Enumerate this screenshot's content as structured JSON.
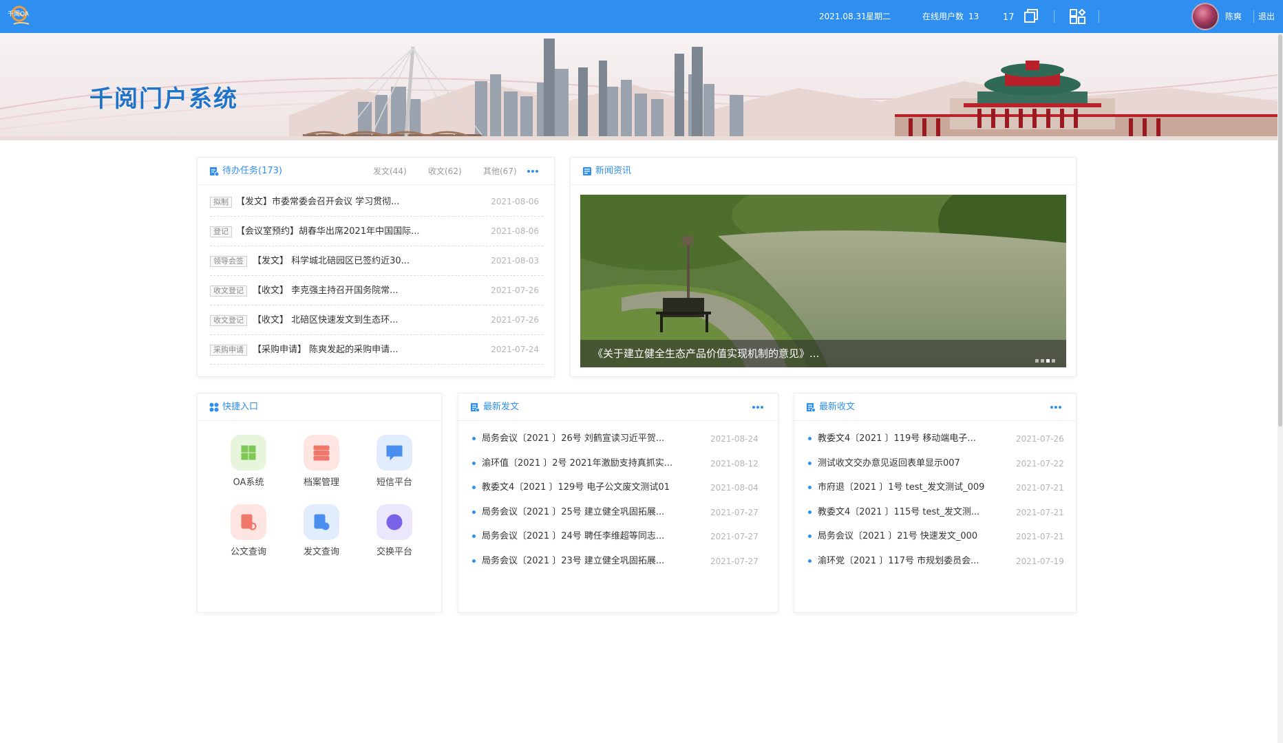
{
  "topbar": {
    "logo_text": "千阅OA",
    "date": "2021.08.31",
    "weekday": "星期二",
    "online_label": "在线用户数",
    "online_count": "13",
    "message_count": "17",
    "username": "陈爽",
    "logout": "退出",
    "bar_color": "#2f8ff0"
  },
  "banner": {
    "title": "千阅门户系统"
  },
  "tasks": {
    "title": "待办任务(173)",
    "tabs": [
      "发文(44)",
      "收文(62)",
      "其他(67)"
    ],
    "items": [
      {
        "tag": "拟制",
        "text": "【发文】市委常委会召开会议 学习贯彻...",
        "date": "2021-08-06"
      },
      {
        "tag": "登记",
        "text": "【会议室预约】胡春华出席2021年中国国际...",
        "date": "2021-08-06"
      },
      {
        "tag": "领导会签",
        "text": "【发文】 科学城北碚园区已签约近30...",
        "date": "2021-08-03"
      },
      {
        "tag": "收文登记",
        "text": "【收文】 李克强主持召开国务院常...",
        "date": "2021-07-26"
      },
      {
        "tag": "收文登记",
        "text": "【收文】 北碚区快速发文到生态环...",
        "date": "2021-07-26"
      },
      {
        "tag": "采购申请",
        "text": "【采购申请】 陈爽发起的采购申请...",
        "date": "2021-07-24"
      }
    ]
  },
  "news": {
    "title": "新闻资讯",
    "caption": "《关于建立健全生态产品价值实现机制的意见》..."
  },
  "quick": {
    "title": "快捷入口",
    "items": [
      {
        "label": "OA系统",
        "icon": "windows-icon",
        "color": "#7dc857",
        "bg": "#e6f5dc"
      },
      {
        "label": "档案管理",
        "icon": "archive-icon",
        "color": "#f0786a",
        "bg": "#fde5e2"
      },
      {
        "label": "短信平台",
        "icon": "message-icon",
        "color": "#4a8ef0",
        "bg": "#e1edfd"
      },
      {
        "label": "公文查询",
        "icon": "doc-search-icon",
        "color": "#f0786a",
        "bg": "#fde5e2"
      },
      {
        "label": "发文查询",
        "icon": "doc-send-icon",
        "color": "#4a8ef0",
        "bg": "#e1edfd"
      },
      {
        "label": "交换平台",
        "icon": "exchange-icon",
        "color": "#7a62e8",
        "bg": "#ebe6fb"
      }
    ]
  },
  "sent": {
    "title": "最新发文",
    "items": [
      {
        "text": "局务会议〔2021 〕26号 刘鹤宣读习近平贺...",
        "date": "2021-08-24"
      },
      {
        "text": "渝环值〔2021 〕2号 2021年激励支持真抓实...",
        "date": "2021-08-12"
      },
      {
        "text": "教委文4〔2021 〕129号 电子公文废文测试01",
        "date": "2021-08-04"
      },
      {
        "text": "局务会议〔2021 〕25号 建立健全巩固拓展...",
        "date": "2021-07-27"
      },
      {
        "text": "局务会议〔2021 〕24号 聘任李维超等同志...",
        "date": "2021-07-27"
      },
      {
        "text": "局务会议〔2021 〕23号 建立健全巩固拓展...",
        "date": "2021-07-27"
      }
    ]
  },
  "received": {
    "title": "最新收文",
    "items": [
      {
        "text": "教委文4〔2021 〕119号 移动端电子...",
        "date": "2021-07-26"
      },
      {
        "text": "测试收文交办意见返回表单显示007",
        "date": "2021-07-22"
      },
      {
        "text": "市府退〔2021 〕1号 test_发文测试_009",
        "date": "2021-07-21"
      },
      {
        "text": "教委文4〔2021 〕115号 test_发文测...",
        "date": "2021-07-21"
      },
      {
        "text": "局务会议〔2021 〕21号 快速发文_000",
        "date": "2021-07-21"
      },
      {
        "text": "渝环党〔2021 〕117号 市规划委员会...",
        "date": "2021-07-19"
      }
    ]
  }
}
